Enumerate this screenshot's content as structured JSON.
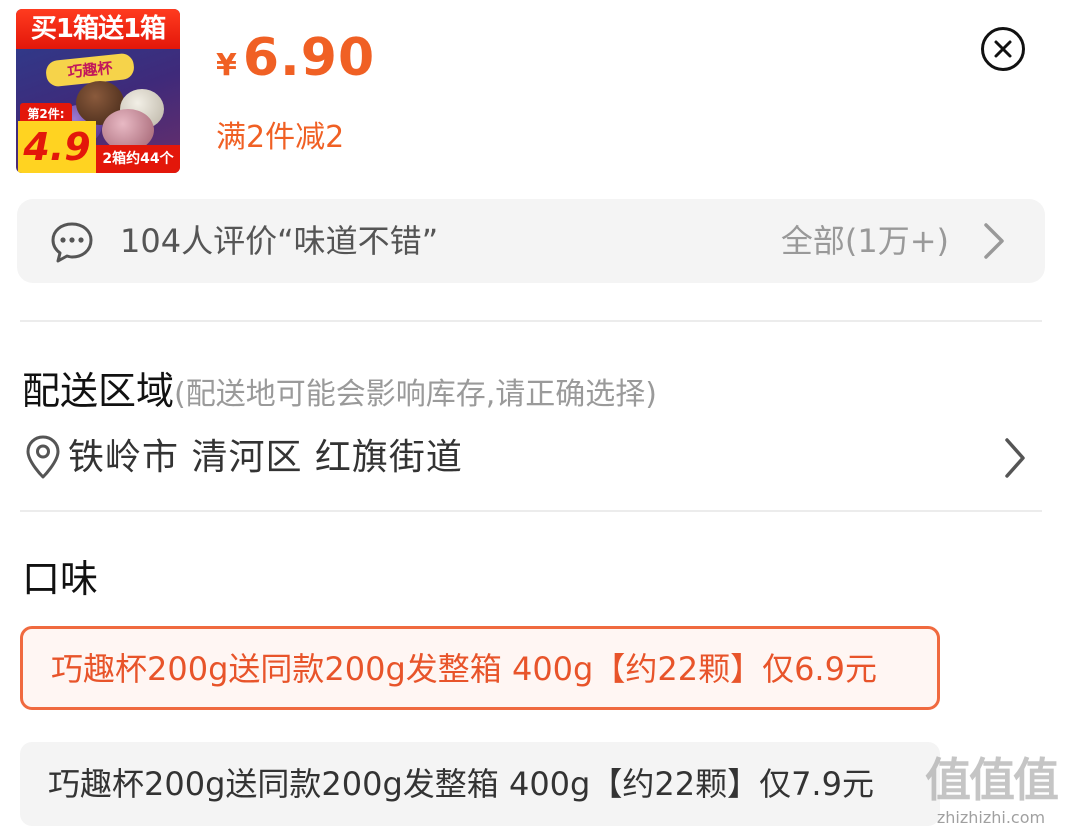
{
  "product": {
    "image": {
      "banner_text": "买1箱送1箱",
      "brand_text": "巧趣杯",
      "second_item_text": "第2件:",
      "second_item_price": "4.9",
      "pack_text": "2箱约44个"
    },
    "price": {
      "currency": "¥",
      "value": "6.90"
    },
    "discount": "满2件减2"
  },
  "close_icon": "close-circle-icon",
  "reviews": {
    "summary": "104人评价“味道不错”",
    "all_label": "全部(1万+)",
    "icon": "chat-bubble-icon"
  },
  "delivery": {
    "title": "配送区域",
    "hint": "(配送地可能会影响库存,请正确选择)",
    "address": "铁岭市 清河区 红旗街道",
    "icon": "location-pin-icon"
  },
  "flavor": {
    "title": "口味",
    "options": [
      {
        "label": "巧趣杯200g送同款200g发整箱 400g【约22颗】仅6.9元",
        "selected": true
      },
      {
        "label": "巧趣杯200g送同款200g发整箱 400g【约22颗】仅7.9元",
        "selected": false
      }
    ]
  },
  "watermark": {
    "logo": "值值值",
    "url": "zhizhizhi.com"
  },
  "colors": {
    "accent": "#f06024",
    "selected_border": "#f06a3f",
    "panel_bg": "#f4f4f4"
  }
}
